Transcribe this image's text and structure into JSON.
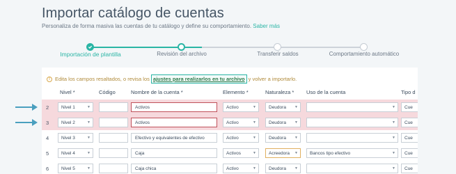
{
  "page": {
    "title": "Importar catálogo de cuentas",
    "subtitle": "Personaliza de forma masiva las cuentas de tu catálogo y define su comportamiento.",
    "subtitle_link": "Saber más"
  },
  "stepper": {
    "steps": [
      {
        "label": "Importación de plantilla",
        "state": "done"
      },
      {
        "label": "Revisión del archivo",
        "state": "current"
      },
      {
        "label": "Transferir saldos",
        "state": "pending"
      },
      {
        "label": "Comportamiento automático",
        "state": "pending"
      }
    ],
    "accent": "#2ab5a5"
  },
  "notice": {
    "before": "Edita los campos resaltados, o revisa los",
    "link": "ajustes para realizarlos en tu archivo",
    "after": "y volver a importarlo."
  },
  "table": {
    "headers": {
      "nivel": "Nivel *",
      "codigo": "Código",
      "nombre": "Nombre de la cuenta *",
      "elemento": "Elemento *",
      "naturaleza": "Naturaleza *",
      "uso": "Uso de la cuenta",
      "tipo": "Tipo d"
    },
    "rows": [
      {
        "num": "2",
        "nivel": "Nivel 1",
        "codigo": "",
        "nombre": "Activos",
        "elemento": "Activo",
        "naturaleza": "Deudora",
        "uso": "",
        "tipo": "Cue",
        "error": true
      },
      {
        "num": "3",
        "nivel": "Nivel 2",
        "codigo": "",
        "nombre": "Activos",
        "elemento": "Activo",
        "naturaleza": "Deudora",
        "uso": "",
        "tipo": "Cue",
        "error": true
      },
      {
        "num": "4",
        "nivel": "Nivel 3",
        "codigo": "",
        "nombre": "Efectivo y equivalentes de efectivo",
        "elemento": "Activo",
        "naturaleza": "Deudora",
        "uso": "",
        "tipo": "Cue",
        "error": false
      },
      {
        "num": "5",
        "nivel": "Nivel 4",
        "codigo": "",
        "nombre": "Caja",
        "elemento": "Activos",
        "naturaleza": "Acreedora",
        "uso": "Bancos tipo efectivo",
        "tipo": "Cue",
        "error": false
      },
      {
        "num": "6",
        "nivel": "Nivel 5",
        "codigo": "",
        "nombre": "Caja chica",
        "elemento": "Activo",
        "naturaleza": "Deudora",
        "uso": "",
        "tipo": "Cue",
        "error": false
      }
    ],
    "error_color": "#f6d9dd"
  }
}
